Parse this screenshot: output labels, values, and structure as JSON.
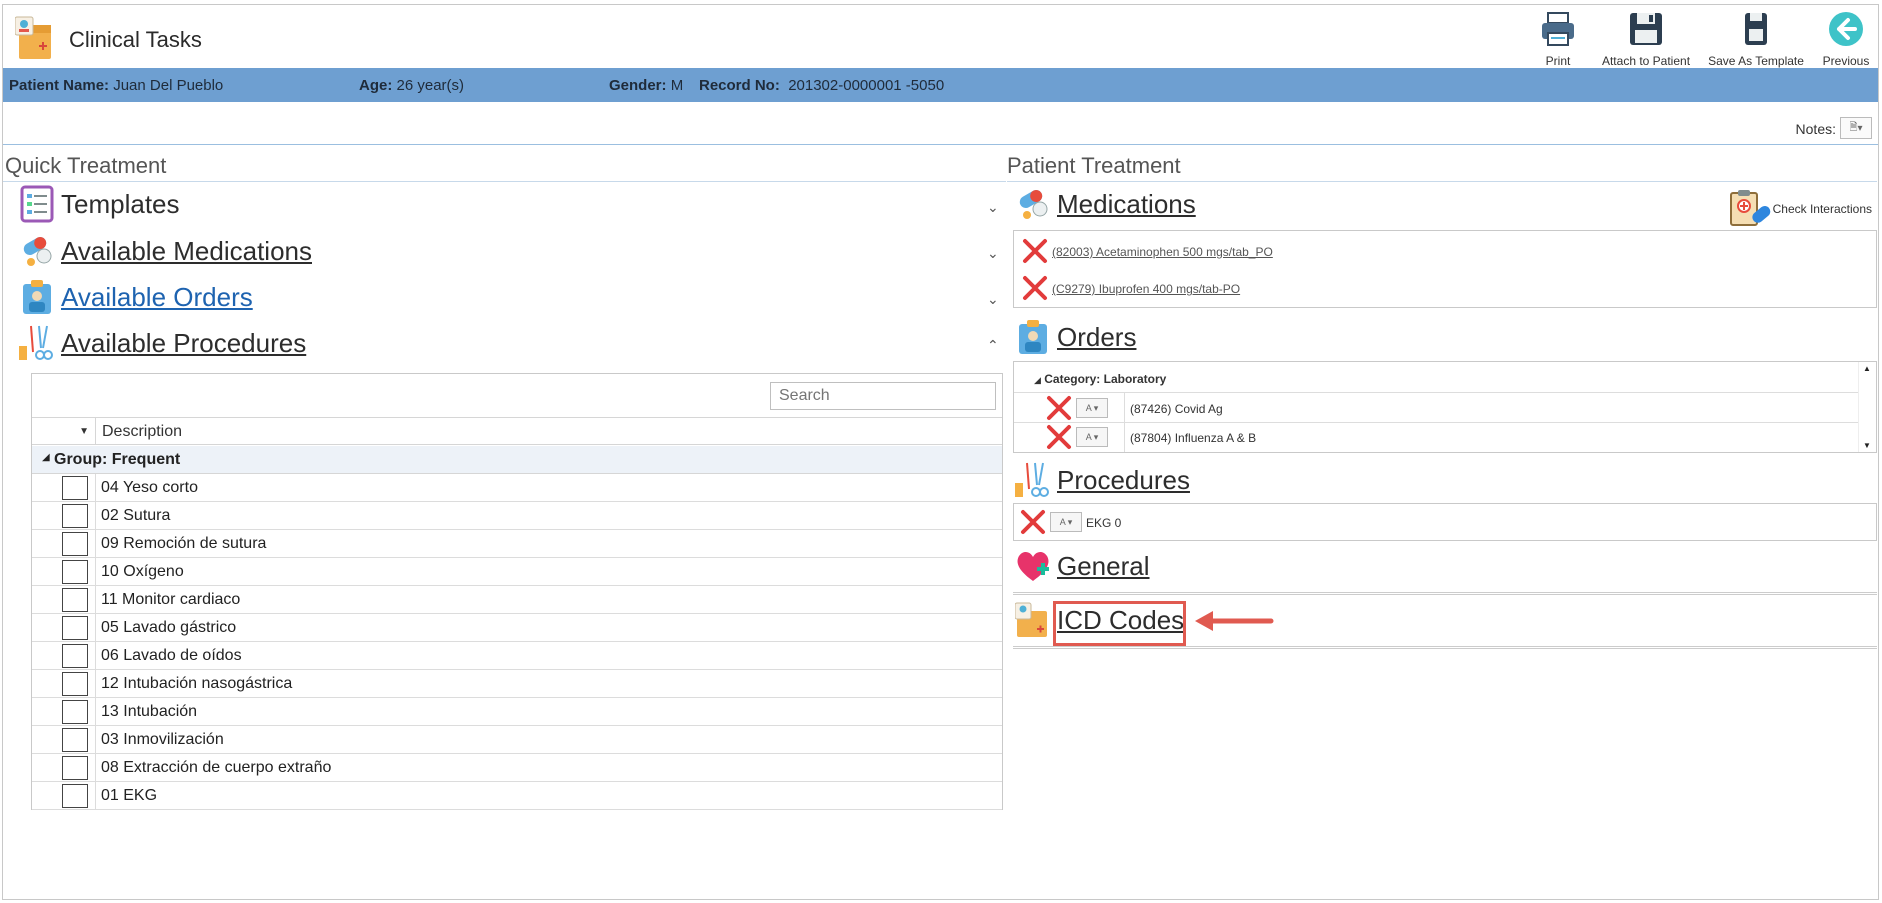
{
  "app": {
    "title": "Clinical Tasks"
  },
  "toolbar": {
    "print": "Print",
    "attach": "Attach to Patient",
    "save_template": "Save As Template",
    "previous": "Previous"
  },
  "patient": {
    "name_label": "Patient Name:",
    "name": "Juan Del Pueblo",
    "age_label": "Age:",
    "age": "26 year(s)",
    "gender_label": "Gender:",
    "gender": "M",
    "record_label": "Record No:",
    "record": "201302-0000001 -5050"
  },
  "notes": {
    "label": "Notes:"
  },
  "quick_treatment": {
    "title": "Quick Treatment",
    "sections": {
      "templates": "Templates",
      "medications": "Available Medications",
      "orders": "Available Orders",
      "procedures": "Available Procedures"
    },
    "grid": {
      "search_placeholder": "Search",
      "col_description": "Description",
      "group": "Group: Frequent",
      "rows": [
        "04 Yeso corto",
        "02 Sutura",
        "09 Remoción de sutura",
        "10 Oxígeno",
        "11 Monitor cardiaco",
        "05 Lavado gástrico",
        "06 Lavado de oídos",
        "12 Intubación nasogástrica",
        "13 Intubación",
        "03 Inmovilización",
        "08 Extracción de cuerpo extraño",
        "01 EKG"
      ]
    }
  },
  "patient_treatment": {
    "title": "Patient Treatment",
    "check_interactions": "Check Interactions",
    "medications": {
      "title": "Medications",
      "items": [
        "(82003) Acetaminophen 500 mgs/tab_PO",
        "(C9279) Ibuprofen 400 mgs/tab-PO"
      ]
    },
    "orders": {
      "title": "Orders",
      "category": "Category: Laboratory",
      "items": [
        "(87426) Covid Ag",
        "(87804) Influenza A & B"
      ]
    },
    "procedures": {
      "title": "Procedures",
      "items": [
        "EKG 0"
      ]
    },
    "general": {
      "title": "General"
    },
    "icd": {
      "title": "ICD Codes"
    }
  },
  "colors": {
    "patient_bar": "#6e9fd1",
    "highlight": "#e05a50",
    "link_blue": "#1e63b0",
    "delete_red": "#e23b3b"
  }
}
